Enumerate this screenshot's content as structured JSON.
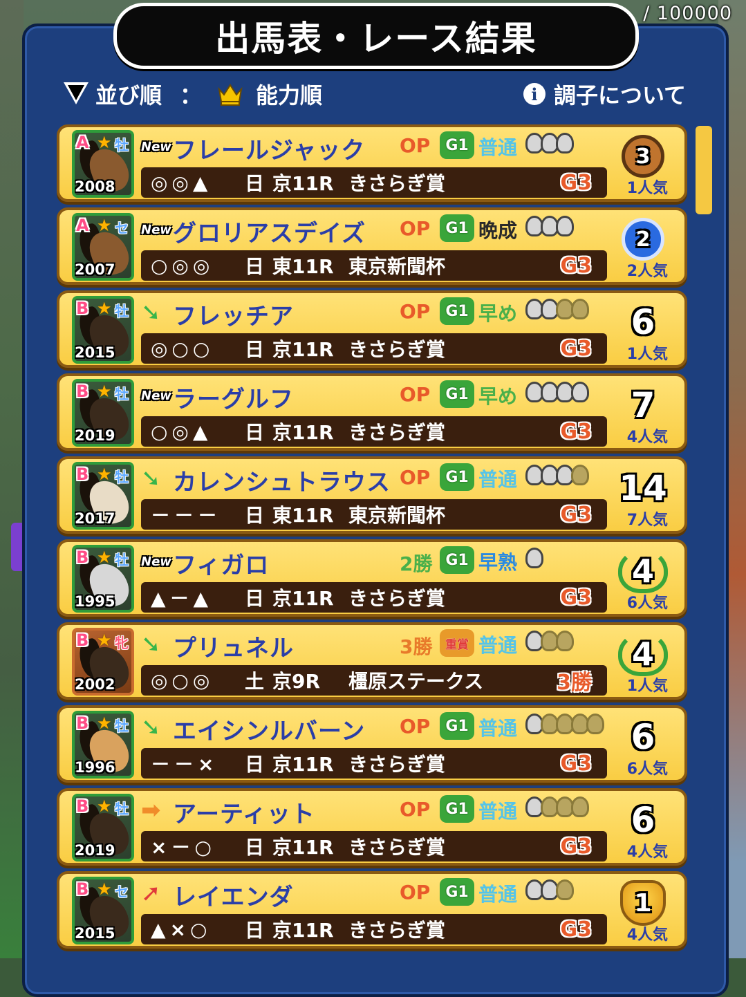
{
  "header": {
    "title": "出馬表・レース結果",
    "currency": "/ 100000"
  },
  "sortbar": {
    "label": "並び順",
    "colon": "：",
    "value": "能力順",
    "info_label": "調子について"
  },
  "rows": [
    {
      "rank": "A",
      "sex": "牡",
      "year": "2008",
      "status": "New",
      "name": "フレールジャック",
      "class": "OP",
      "grade_badge": "G1",
      "growth": "普通",
      "shoes": 3,
      "shoes_dim": 0,
      "marks": "◎◎▲",
      "day": "日",
      "race": "京11R",
      "race_name": "きさらぎ賞",
      "race_grade": "G3",
      "result": "3",
      "result_type": "medal-bronze",
      "popularity": "1人気",
      "head": "brown"
    },
    {
      "rank": "A",
      "sex": "セ",
      "year": "2007",
      "status": "New",
      "name": "グロリアスデイズ",
      "class": "OP",
      "grade_badge": "G1",
      "growth": "晩成",
      "shoes": 3,
      "shoes_dim": 0,
      "marks": "○◎◎",
      "day": "日",
      "race": "東11R",
      "race_name": "東京新聞杯",
      "race_grade": "G3",
      "result": "2",
      "result_type": "medal-silver",
      "popularity": "2人気",
      "head": "brown"
    },
    {
      "rank": "B",
      "sex": "牡",
      "year": "2015",
      "status": "down",
      "name": "フレッチア",
      "class": "OP",
      "grade_badge": "G1",
      "growth": "早め",
      "shoes": 2,
      "shoes_dim": 2,
      "marks": "◎○○",
      "day": "日",
      "race": "京11R",
      "race_name": "きさらぎ賞",
      "race_grade": "G3",
      "result": "6",
      "result_type": "number",
      "popularity": "1人気",
      "head": "dark"
    },
    {
      "rank": "B",
      "sex": "牡",
      "year": "2019",
      "status": "New",
      "name": "ラーグルフ",
      "class": "OP",
      "grade_badge": "G1",
      "growth": "早め",
      "shoes": 4,
      "shoes_dim": 0,
      "marks": "○◎▲",
      "day": "日",
      "race": "京11R",
      "race_name": "きさらぎ賞",
      "race_grade": "G3",
      "result": "7",
      "result_type": "number",
      "popularity": "4人気",
      "head": "dark"
    },
    {
      "rank": "B",
      "sex": "牡",
      "year": "2017",
      "status": "down",
      "name": "カレンシュトラウス",
      "class": "OP",
      "grade_badge": "G1",
      "growth": "普通",
      "shoes": 3,
      "shoes_dim": 1,
      "marks": "－－－",
      "day": "日",
      "race": "東11R",
      "race_name": "東京新聞杯",
      "race_grade": "G3",
      "result": "14",
      "result_type": "number",
      "popularity": "7人気",
      "head": "light"
    },
    {
      "rank": "B",
      "sex": "牡",
      "year": "1995",
      "status": "New",
      "name": "フィガロ",
      "class": "2勝",
      "grade_badge": "G1",
      "growth": "早熟",
      "shoes": 1,
      "shoes_dim": 0,
      "marks": "▲－▲",
      "day": "日",
      "race": "京11R",
      "race_name": "きさらぎ賞",
      "race_grade": "G3",
      "result": "4",
      "result_type": "laurel",
      "popularity": "6人気",
      "head": "gray"
    },
    {
      "rank": "B",
      "sex": "牝",
      "year": "2002",
      "status": "down",
      "name": "プリュネル",
      "class": "3勝",
      "grade_badge": "重賞",
      "growth": "普通",
      "shoes": 1,
      "shoes_dim": 2,
      "marks": "◎○◎",
      "day": "土",
      "race": "京9R",
      "race_name": "橿原ステークス",
      "race_grade": "3勝",
      "result": "4",
      "result_type": "laurel",
      "popularity": "1人気",
      "head": "dark"
    },
    {
      "rank": "B",
      "sex": "牡",
      "year": "1996",
      "status": "down",
      "name": "エイシンルバーン",
      "class": "OP",
      "grade_badge": "G1",
      "growth": "普通",
      "shoes": 1,
      "shoes_dim": 4,
      "marks": "－－×",
      "day": "日",
      "race": "京11R",
      "race_name": "きさらぎ賞",
      "race_grade": "G3",
      "result": "6",
      "result_type": "number",
      "popularity": "6人気",
      "head": "tan"
    },
    {
      "rank": "B",
      "sex": "牡",
      "year": "2019",
      "status": "right",
      "name": "アーティット",
      "class": "OP",
      "grade_badge": "G1",
      "growth": "普通",
      "shoes": 1,
      "shoes_dim": 3,
      "marks": "×－○",
      "day": "日",
      "race": "京11R",
      "race_name": "きさらぎ賞",
      "race_grade": "G3",
      "result": "6",
      "result_type": "number",
      "popularity": "4人気",
      "head": "dark"
    },
    {
      "rank": "B",
      "sex": "セ",
      "year": "2015",
      "status": "up",
      "name": "レイエンダ",
      "class": "OP",
      "grade_badge": "G1",
      "growth": "普通",
      "shoes": 2,
      "shoes_dim": 1,
      "marks": "▲×○",
      "day": "日",
      "race": "京11R",
      "race_name": "きさらぎ賞",
      "race_grade": "G3",
      "result": "1",
      "result_type": "trophy",
      "popularity": "4人気",
      "head": "dark"
    }
  ]
}
